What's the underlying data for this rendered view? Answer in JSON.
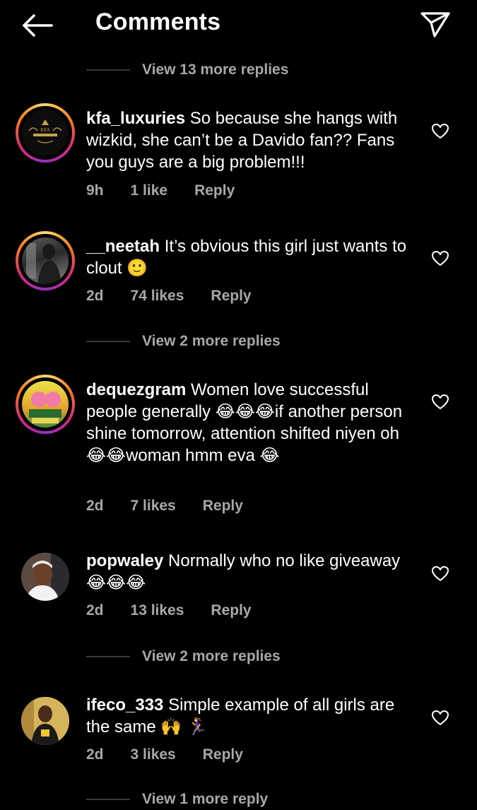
{
  "header": {
    "title": "Comments"
  },
  "view_replies": [
    {
      "text": "View 13 more replies"
    },
    {
      "text": "View 2 more replies"
    },
    {
      "text": "View 2 more replies"
    },
    {
      "text": "View 1 more reply"
    }
  ],
  "comments": [
    {
      "username": "kfa_luxuries",
      "text": " So because she hangs with wizkid, she can’t be a Davido fan?? Fans you guys are a big problem!!!",
      "time": "9h",
      "likes": "1 like",
      "reply": "Reply",
      "avatar_label": "KFA"
    },
    {
      "username": "__neetah",
      "text": " It’s obvious this girl just wants to clout 🙂",
      "time": "2d",
      "likes": "74 likes",
      "reply": "Reply"
    },
    {
      "username": "dequezgram",
      "text": " Women love successful people generally 😂😂😂if another person shine tomorrow, attention shifted niyen oh😂😂woman hmm eva 😂",
      "time": "2d",
      "likes": "7 likes",
      "reply": "Reply"
    },
    {
      "username": "popwaley",
      "text": " Normally who no like giveaway 😂😂😂",
      "time": "2d",
      "likes": "13 likes",
      "reply": "Reply"
    },
    {
      "username": "ifeco_333",
      "text": " Simple example of all girls are the same 🙌 🏃‍♀️",
      "time": "2d",
      "likes": "3 likes",
      "reply": "Reply"
    }
  ]
}
